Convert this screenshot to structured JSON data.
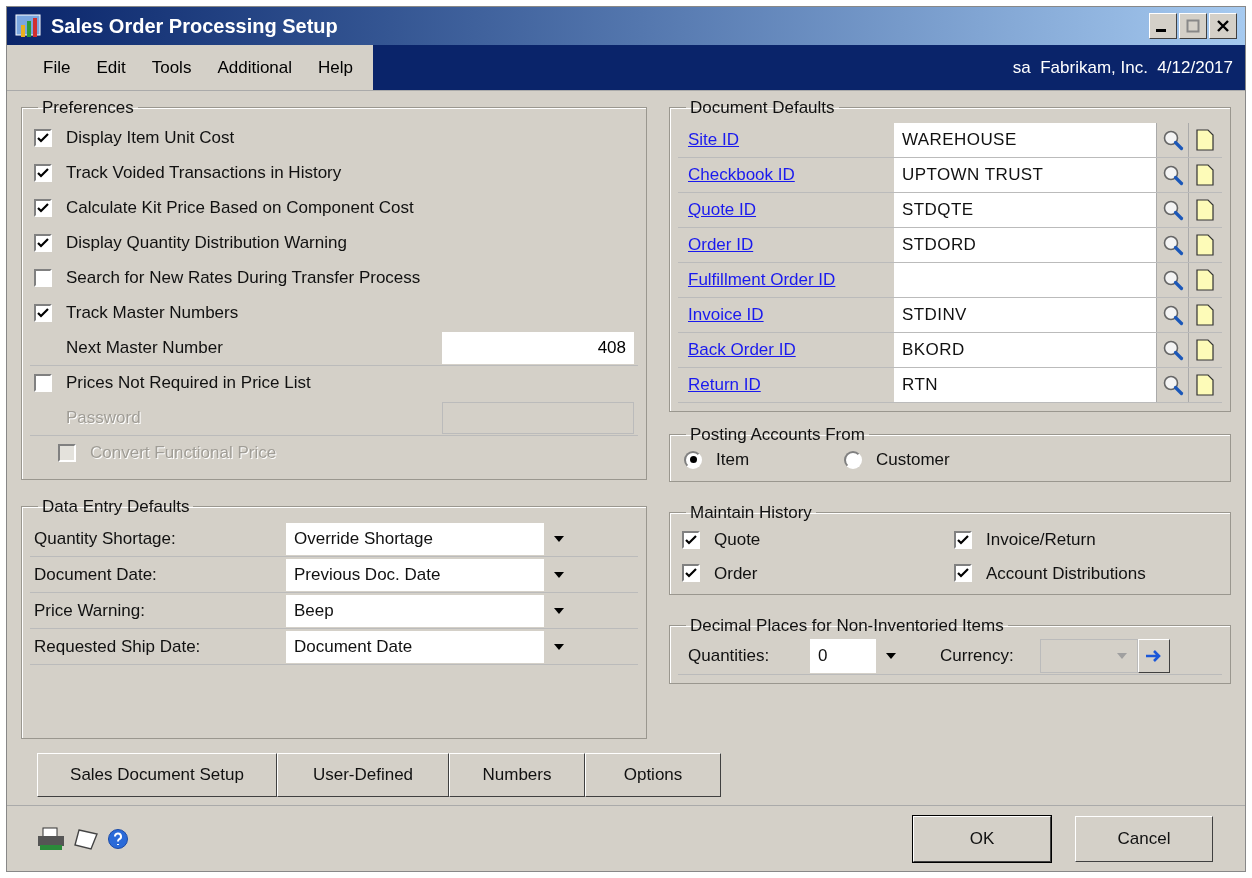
{
  "window": {
    "title": "Sales Order Processing Setup"
  },
  "menu": [
    {
      "label": "File"
    },
    {
      "label": "Edit"
    },
    {
      "label": "Tools"
    },
    {
      "label": "Additional"
    },
    {
      "label": "Help"
    }
  ],
  "user_info": "sa  Fabrikam, Inc.  4/12/2017",
  "preferences": {
    "title": "Preferences",
    "items": [
      {
        "kind": "checkbox",
        "label": "Display Item Unit Cost",
        "checked": true,
        "disabled": false
      },
      {
        "kind": "checkbox",
        "label": "Track Voided Transactions in History",
        "checked": true,
        "disabled": false
      },
      {
        "kind": "checkbox",
        "label": "Calculate Kit Price Based on Component Cost",
        "checked": true,
        "disabled": false
      },
      {
        "kind": "checkbox",
        "label": "Display Quantity Distribution Warning",
        "checked": true,
        "disabled": false
      },
      {
        "kind": "checkbox",
        "label": "Search for New Rates During Transfer Process",
        "checked": false,
        "disabled": false
      },
      {
        "kind": "checkbox",
        "label": "Track Master Numbers",
        "checked": true,
        "disabled": false
      },
      {
        "kind": "field",
        "label": "Next Master Number",
        "value": "408",
        "disabled": false
      },
      {
        "kind": "checkbox",
        "label": "Prices Not Required in Price List",
        "checked": false,
        "disabled": false
      },
      {
        "kind": "field",
        "label": "Password",
        "disabled": true
      },
      {
        "kind": "sub_checkbox",
        "label": "Convert Functional Price",
        "checked": false,
        "disabled": true
      }
    ]
  },
  "data_entry_defaults": {
    "title": "Data Entry Defaults",
    "rows": [
      {
        "label": "Quantity Shortage:",
        "value": "Override Shortage"
      },
      {
        "label": "Document Date:",
        "value": "Previous Doc. Date"
      },
      {
        "label": "Price Warning:",
        "value": "Beep"
      },
      {
        "label": "Requested Ship Date:",
        "value": "Document Date"
      }
    ]
  },
  "document_defaults": {
    "title": "Document Defaults",
    "rows": [
      {
        "label": "Site ID",
        "value": "WAREHOUSE"
      },
      {
        "label": "Checkbook ID",
        "value": "UPTOWN TRUST"
      },
      {
        "label": "Quote ID",
        "value": "STDQTE"
      },
      {
        "label": "Order ID",
        "value": "STDORD"
      },
      {
        "label": "Fulfillment Order ID"
      },
      {
        "label": "Invoice ID",
        "value": "STDINV"
      },
      {
        "label": "Back Order ID",
        "value": "BKORD"
      },
      {
        "label": "Return ID",
        "value": "RTN"
      }
    ]
  },
  "posting_accounts_from": {
    "title": "Posting Accounts From",
    "options": [
      {
        "label": "Item",
        "selected": true
      },
      {
        "label": "Customer",
        "selected": false
      }
    ]
  },
  "maintain_history": {
    "title": "Maintain History",
    "items": [
      {
        "label": "Quote",
        "checked": true
      },
      {
        "label": "Invoice/Return",
        "checked": true
      },
      {
        "label": "Order",
        "checked": true
      },
      {
        "label": "Account Distributions",
        "checked": true
      }
    ]
  },
  "decimal_places": {
    "title": "Decimal Places for Non-Inventoried Items",
    "quantities_label": "Quantities:",
    "quantities_value": "0",
    "currency_label": "Currency:",
    "currency_disabled": true
  },
  "action_buttons": [
    {
      "label": "Sales Document Setup"
    },
    {
      "label": "User-Defined"
    },
    {
      "label": "Numbers"
    },
    {
      "label": "Options"
    }
  ],
  "footer_buttons": [
    {
      "label": "OK",
      "default": true
    },
    {
      "label": "Cancel",
      "default": false
    }
  ]
}
